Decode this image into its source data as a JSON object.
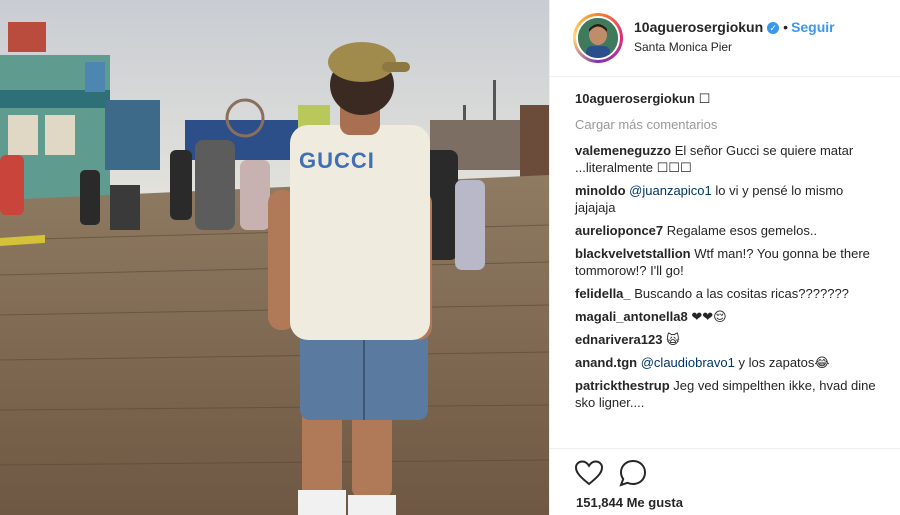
{
  "header": {
    "username": "10aguerosergiokun",
    "verified_mark": "✓",
    "separator": "•",
    "follow_label": "Seguir",
    "location": "Santa Monica Pier"
  },
  "caption": {
    "username": "10aguerosergiokun",
    "text": "☐"
  },
  "load_more_label": "Cargar más comentarios",
  "comments": [
    {
      "user": "valemeneguzzo",
      "text": "El señor Gucci se quiere matar ...literalmente ☐☐☐"
    },
    {
      "user": "minoldo",
      "mention": "@juanzapico1",
      "text": "lo vi y pensé lo mismo jajajaja"
    },
    {
      "user": "aurelioponce7",
      "text": "Regalame esos gemelos.."
    },
    {
      "user": "blackvelvetstallion",
      "text": "Wtf man!? You gonna be there tommorow!? I'll go!"
    },
    {
      "user": "felidella_",
      "text": "Buscando a las cositas ricas???????"
    },
    {
      "user": "magali_antonella8",
      "text": "❤❤😌"
    },
    {
      "user": "ednarivera123",
      "text": "🙀"
    },
    {
      "user": "anand.tgn",
      "mention": "@claudiobravo1",
      "text": "y los zapatos😂"
    },
    {
      "user": "patrickthestrup",
      "text": "Jeg ved simpelthen ikke, hvad dine sko ligner...."
    }
  ],
  "actions": {
    "like_icon": "heart-outline-icon",
    "comment_icon": "speech-bubble-icon"
  },
  "likes_label": "151,844 Me gusta",
  "photo": {
    "shirt_print": "GUCCI"
  },
  "colors": {
    "link_blue": "#3897f0",
    "mention_blue": "#003569",
    "muted_gray": "#999999",
    "text_dark": "#262626"
  }
}
